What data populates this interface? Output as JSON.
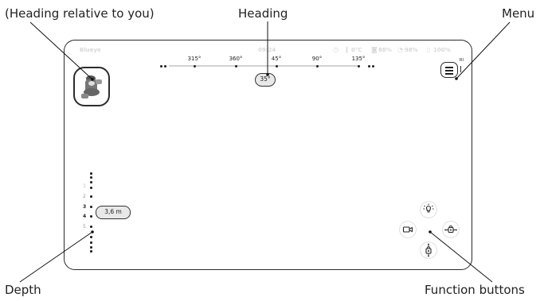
{
  "callouts": {
    "relative_heading": "(Heading relative to you)",
    "heading": "Heading",
    "menu": "Menu",
    "depth": "Depth",
    "function_buttons": "Function buttons"
  },
  "status_bar": {
    "network": "Blueye",
    "time": "09:24",
    "temperature": "0°C",
    "indicator_1": "88%",
    "indicator_2": "98%",
    "battery": "100%"
  },
  "compass": {
    "ticks": [
      "315°",
      "360°",
      "45°",
      "90°",
      "135°"
    ],
    "current_heading": "35°"
  },
  "menu_badge": "RI",
  "depth": {
    "scale": [
      "1",
      "2",
      "3",
      "4",
      "5"
    ],
    "current": "3,6 m"
  },
  "function_buttons": [
    "light-icon",
    "camera-icon",
    "position-icon",
    "tilt-icon"
  ],
  "colors": {
    "outline": "#2a2a2a",
    "status_text": "#d8d8d8",
    "compass_line": "#d2d2d2",
    "pill_fill": "#e8e8e8"
  }
}
